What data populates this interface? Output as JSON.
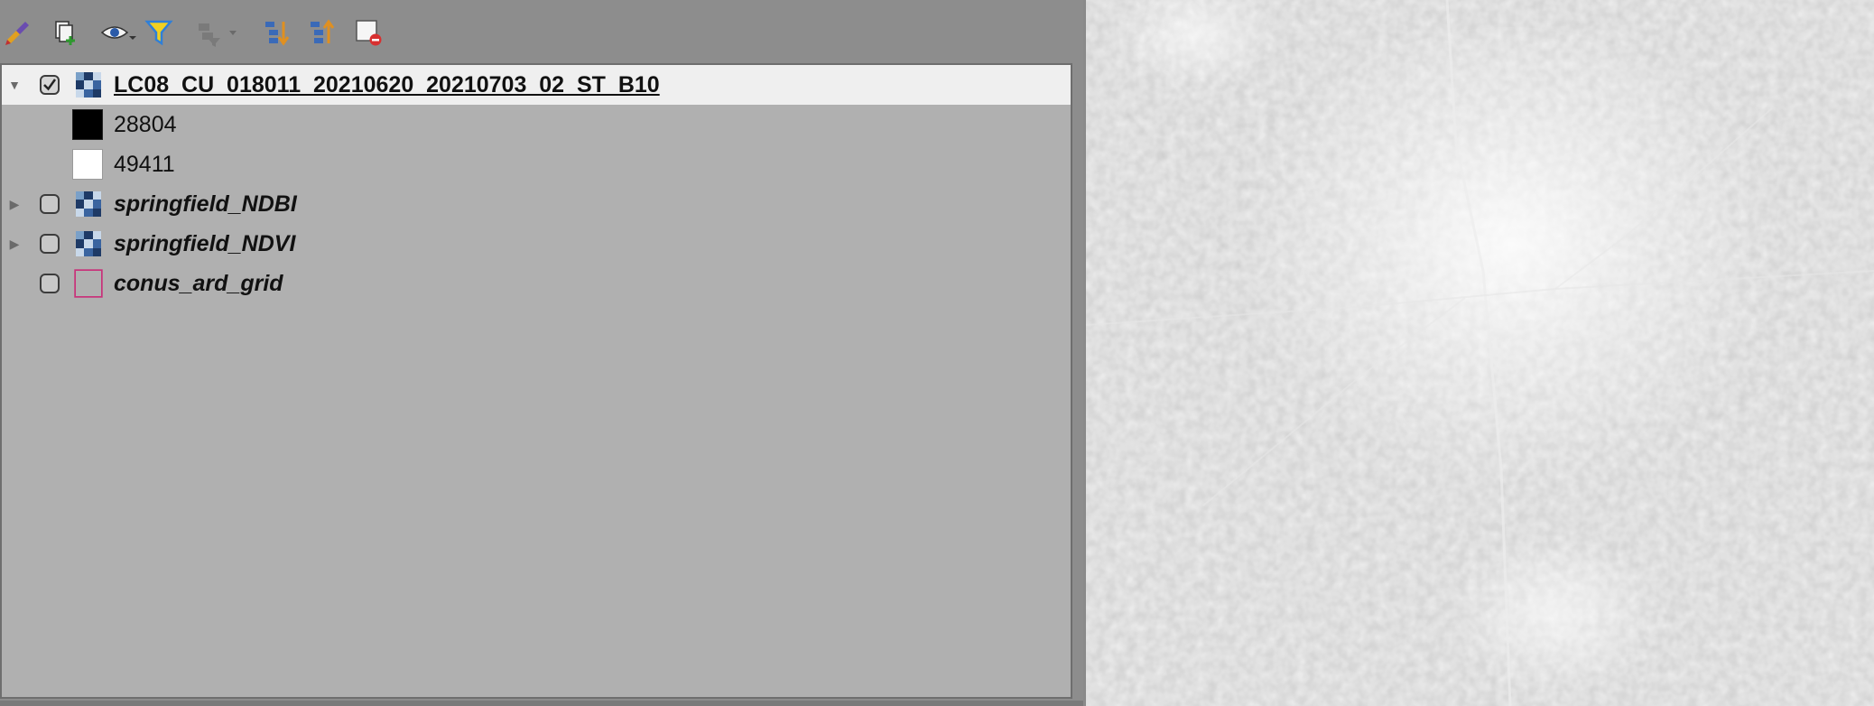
{
  "toolbar": {
    "buttons": [
      {
        "name": "style-manager-button",
        "icon": "paintbrush-icon"
      },
      {
        "name": "add-group-button",
        "icon": "add-group-icon"
      },
      {
        "name": "visibility-button",
        "icon": "eye-icon"
      },
      {
        "name": "filter-legend-button",
        "icon": "filter-icon"
      },
      {
        "name": "filter-expression-button",
        "icon": "filter-expression-icon"
      },
      {
        "name": "expand-all-button",
        "icon": "expand-all-icon"
      },
      {
        "name": "collapse-all-button",
        "icon": "collapse-all-icon"
      },
      {
        "name": "remove-layer-button",
        "icon": "remove-layer-icon"
      }
    ]
  },
  "layers": [
    {
      "name": "LC08_CU_018011_20210620_20210703_02_ST_B10",
      "checked": true,
      "expanded": true,
      "type": "raster",
      "legend": [
        {
          "label": "28804",
          "color": "#000000"
        },
        {
          "label": "49411",
          "color": "#ffffff"
        }
      ]
    },
    {
      "name": "springfield_NDBI",
      "checked": false,
      "expanded": false,
      "type": "raster"
    },
    {
      "name": "springfield_NDVI",
      "checked": false,
      "expanded": false,
      "type": "raster"
    },
    {
      "name": "conus_ard_grid",
      "checked": false,
      "expanded": false,
      "type": "polygon",
      "color": "#c8327a"
    }
  ],
  "colors": {
    "panel_bg": "#b0b0b0",
    "selected_row_bg": "#efefef",
    "accent_filter": "#2f7fd8",
    "grid_outline": "#c8327a"
  }
}
